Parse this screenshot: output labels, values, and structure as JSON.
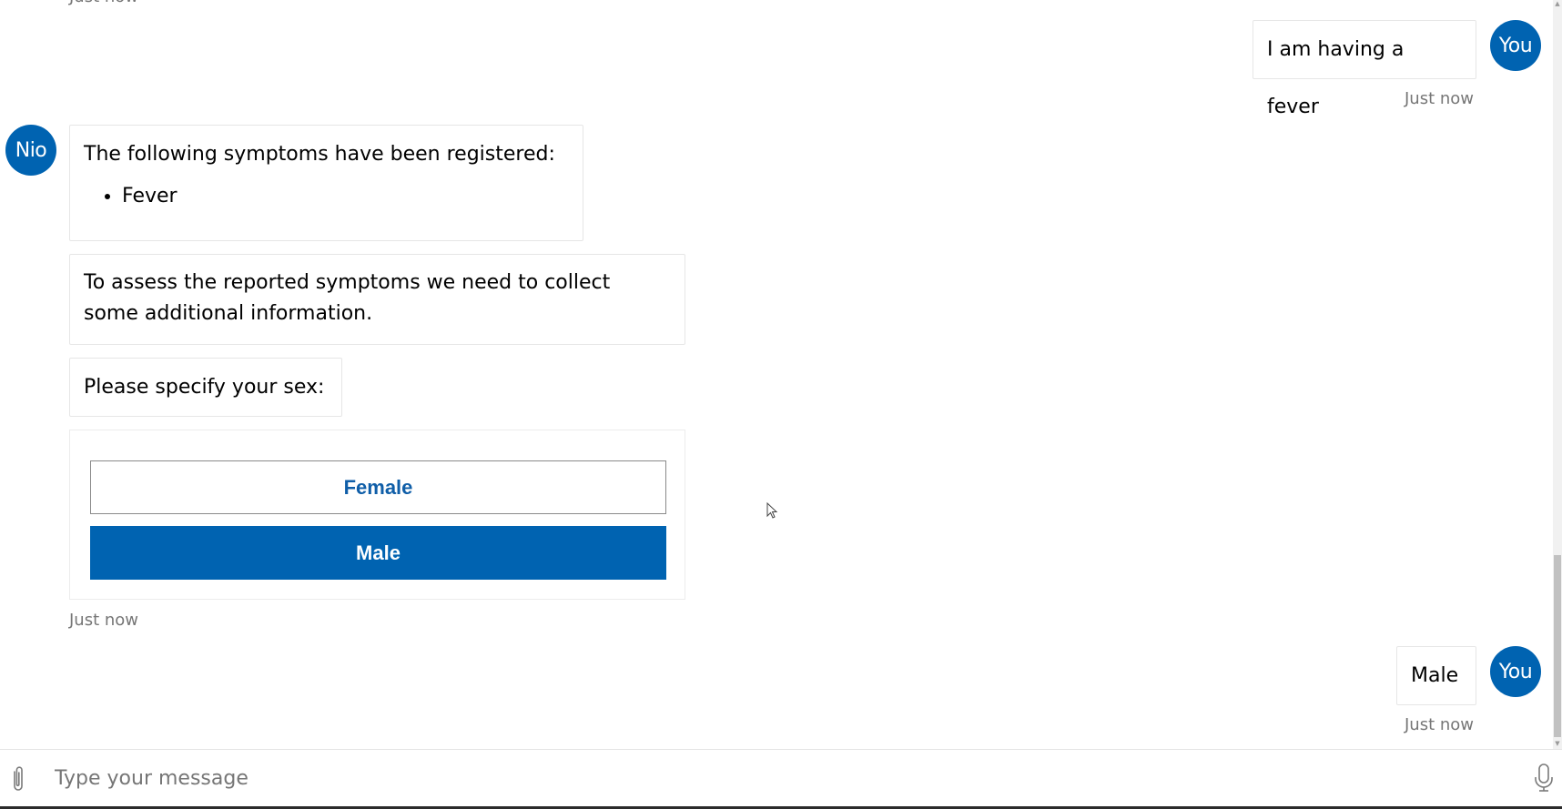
{
  "transcript": {
    "previous_timestamp": "Just now",
    "messages": [
      {
        "from": "user",
        "avatar_label": "You",
        "text": "I am having a fever",
        "timestamp": "Just now"
      },
      {
        "from": "bot",
        "avatar_label": "Nio",
        "symptoms_intro": "The following symptoms have been registered:",
        "symptoms": [
          "Fever"
        ],
        "info_request": "To assess the reported symptoms we need to collect some additional information.",
        "sex_prompt": "Please specify your sex:",
        "choices": [
          "Female",
          "Male"
        ],
        "timestamp": "Just now"
      },
      {
        "from": "user",
        "avatar_label": "You",
        "text": "Male",
        "timestamp": "Just now"
      }
    ]
  },
  "composer": {
    "placeholder": "Type your message",
    "value": "",
    "attach_icon": "paperclip-icon",
    "mic_icon": "microphone-icon"
  },
  "colors": {
    "accent": "#0063b1",
    "choice_text": "#0f5ea8",
    "timestamp": "#767676",
    "bubble_border": "#e6e6e6"
  }
}
